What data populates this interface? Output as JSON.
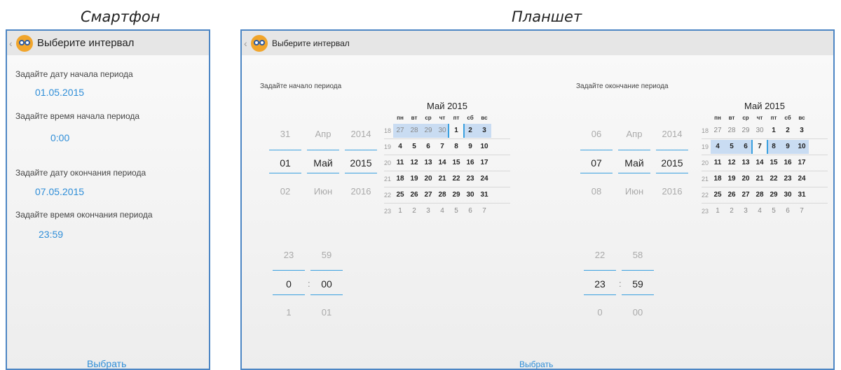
{
  "captions": {
    "phone": "Смартфон",
    "tablet": "Планшет"
  },
  "phone": {
    "title": "Выберите интервал",
    "start_date_label": "Задайте дату начала периода",
    "start_date": "01.05.2015",
    "start_time_label": "Задайте время начала периода",
    "start_time": "0:00",
    "end_date_label": "Задайте дату окончания периода",
    "end_date": "07.05.2015",
    "end_time_label": "Задайте время окончания периода",
    "end_time": "23:59",
    "select_label": "Выбрать"
  },
  "tablet": {
    "title": "Выберите интервал",
    "select_label": "Выбрать",
    "start": {
      "label": "Задайте начало периода",
      "day": [
        "31",
        "01",
        "02"
      ],
      "month": [
        "Апр",
        "Май",
        "Июн"
      ],
      "year": [
        "2014",
        "2015",
        "2016"
      ],
      "hour": [
        "23",
        "0",
        "1"
      ],
      "minute": [
        "59",
        "00",
        "01"
      ],
      "colon": ":"
    },
    "end": {
      "label": "Задайте окончание периода",
      "day": [
        "06",
        "07",
        "08"
      ],
      "month": [
        "Апр",
        "Май",
        "Июн"
      ],
      "year": [
        "2014",
        "2015",
        "2016"
      ],
      "hour": [
        "22",
        "23",
        "0"
      ],
      "minute": [
        "58",
        "59",
        "00"
      ],
      "colon": ":"
    },
    "calendar": {
      "title": "Май 2015",
      "weekdays": [
        "пн",
        "вт",
        "ср",
        "чт",
        "пт",
        "сб",
        "вс"
      ],
      "weeks": [
        {
          "num": "18",
          "days": [
            "27",
            "28",
            "29",
            "30",
            "1",
            "2",
            "3"
          ]
        },
        {
          "num": "19",
          "days": [
            "4",
            "5",
            "6",
            "7",
            "8",
            "9",
            "10"
          ]
        },
        {
          "num": "20",
          "days": [
            "11",
            "12",
            "13",
            "14",
            "15",
            "16",
            "17"
          ]
        },
        {
          "num": "21",
          "days": [
            "18",
            "19",
            "20",
            "21",
            "22",
            "23",
            "24"
          ]
        },
        {
          "num": "22",
          "days": [
            "25",
            "26",
            "27",
            "28",
            "29",
            "30",
            "31"
          ]
        },
        {
          "num": "23",
          "days": [
            "1",
            "2",
            "3",
            "4",
            "5",
            "6",
            "7"
          ]
        }
      ]
    }
  },
  "colors": {
    "accent": "#2f8ed8",
    "highlight": "#c9dcf2",
    "frame": "#4d86c4"
  }
}
